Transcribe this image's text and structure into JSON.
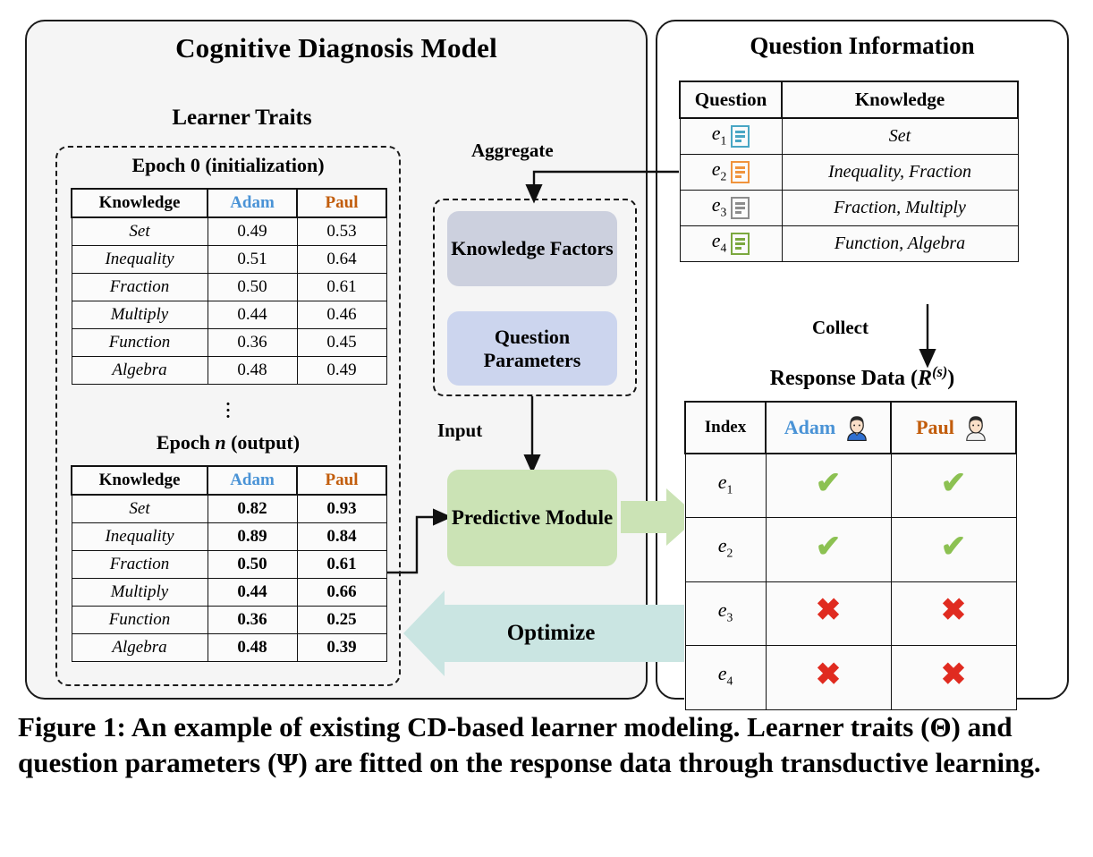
{
  "left_panel": {
    "title": "Cognitive Diagnosis Model",
    "section_title": "Learner Traits",
    "epoch0": {
      "label": "Epoch 0 (initialization)",
      "headers": [
        "Knowledge",
        "Adam",
        "Paul"
      ],
      "rows": [
        {
          "knowledge": "Set",
          "adam": "0.49",
          "paul": "0.53"
        },
        {
          "knowledge": "Inequality",
          "adam": "0.51",
          "paul": "0.64"
        },
        {
          "knowledge": "Fraction",
          "adam": "0.50",
          "paul": "0.61"
        },
        {
          "knowledge": "Multiply",
          "adam": "0.44",
          "paul": "0.46"
        },
        {
          "knowledge": "Function",
          "adam": "0.36",
          "paul": "0.45"
        },
        {
          "knowledge": "Algebra",
          "adam": "0.48",
          "paul": "0.49"
        }
      ]
    },
    "ellipsis": "⋮",
    "epochn": {
      "label_prefix": "Epoch ",
      "label_var": "n",
      "label_suffix": " (output)",
      "headers": [
        "Knowledge",
        "Adam",
        "Paul"
      ],
      "rows": [
        {
          "knowledge": "Set",
          "adam": "0.82",
          "paul": "0.93"
        },
        {
          "knowledge": "Inequality",
          "adam": "0.89",
          "paul": "0.84"
        },
        {
          "knowledge": "Fraction",
          "adam": "0.50",
          "paul": "0.61"
        },
        {
          "knowledge": "Multiply",
          "adam": "0.44",
          "paul": "0.66"
        },
        {
          "knowledge": "Function",
          "adam": "0.36",
          "paul": "0.25"
        },
        {
          "knowledge": "Algebra",
          "adam": "0.48",
          "paul": "0.39"
        }
      ]
    }
  },
  "center": {
    "aggregate_label": "Aggregate",
    "input_label": "Input",
    "knowledge_factors": "Knowledge Factors",
    "question_parameters": "Question Parameters",
    "predictive_module": "Predictive Module",
    "optimize_label": "Optimize"
  },
  "right_panel": {
    "title": "Question Information",
    "question_table": {
      "headers": [
        "Question",
        "Knowledge"
      ],
      "rows": [
        {
          "id": "e",
          "sub": "1",
          "icon": "document-lines-icon",
          "icon_color": "#49a6c4",
          "knowledge": "Set"
        },
        {
          "id": "e",
          "sub": "2",
          "icon": "document-lines-icon",
          "icon_color": "#f0943d",
          "knowledge": "Inequality, Fraction"
        },
        {
          "id": "e",
          "sub": "3",
          "icon": "document-lines-icon",
          "icon_color": "#8c8c8c",
          "knowledge": "Fraction, Multiply"
        },
        {
          "id": "e",
          "sub": "4",
          "icon": "document-lines-icon",
          "icon_color": "#7ba83f",
          "knowledge": "Function, Algebra"
        }
      ]
    },
    "collect_label": "Collect",
    "response_title_main": "Response Data (",
    "response_title_var": "R",
    "response_title_sup": "(s)",
    "response_title_end": ")",
    "response_table": {
      "headers": [
        "Index",
        "Adam",
        "Paul"
      ],
      "rows": [
        {
          "index": "e",
          "sub": "1",
          "adam": "✔",
          "paul": "✔",
          "adam_correct": true,
          "paul_correct": true
        },
        {
          "index": "e",
          "sub": "2",
          "adam": "✔",
          "paul": "✔",
          "adam_correct": true,
          "paul_correct": true
        },
        {
          "index": "e",
          "sub": "3",
          "adam": "✖",
          "paul": "✖",
          "adam_correct": false,
          "paul_correct": false
        },
        {
          "index": "e",
          "sub": "4",
          "adam": "✖",
          "paul": "✖",
          "adam_correct": false,
          "paul_correct": false
        }
      ]
    }
  },
  "caption": "Figure 1: An example of existing CD-based learner modeling. Learner traits (Θ) and question parameters (Ψ) are fitted on the response data through transductive learning.",
  "colors": {
    "adam": "#4a93d6",
    "paul": "#c25d0c",
    "knowledge_factors_box": "#ccd0de",
    "question_parameters_box": "#ccd5ee",
    "predictive_module_box": "#cbe3b5",
    "optimize_arrow": "#cae5e2",
    "predict_arrow": "#cbe3b5",
    "tick": "#8cc152",
    "cross": "#e02b20",
    "panel_bg": "#f5f5f5"
  }
}
